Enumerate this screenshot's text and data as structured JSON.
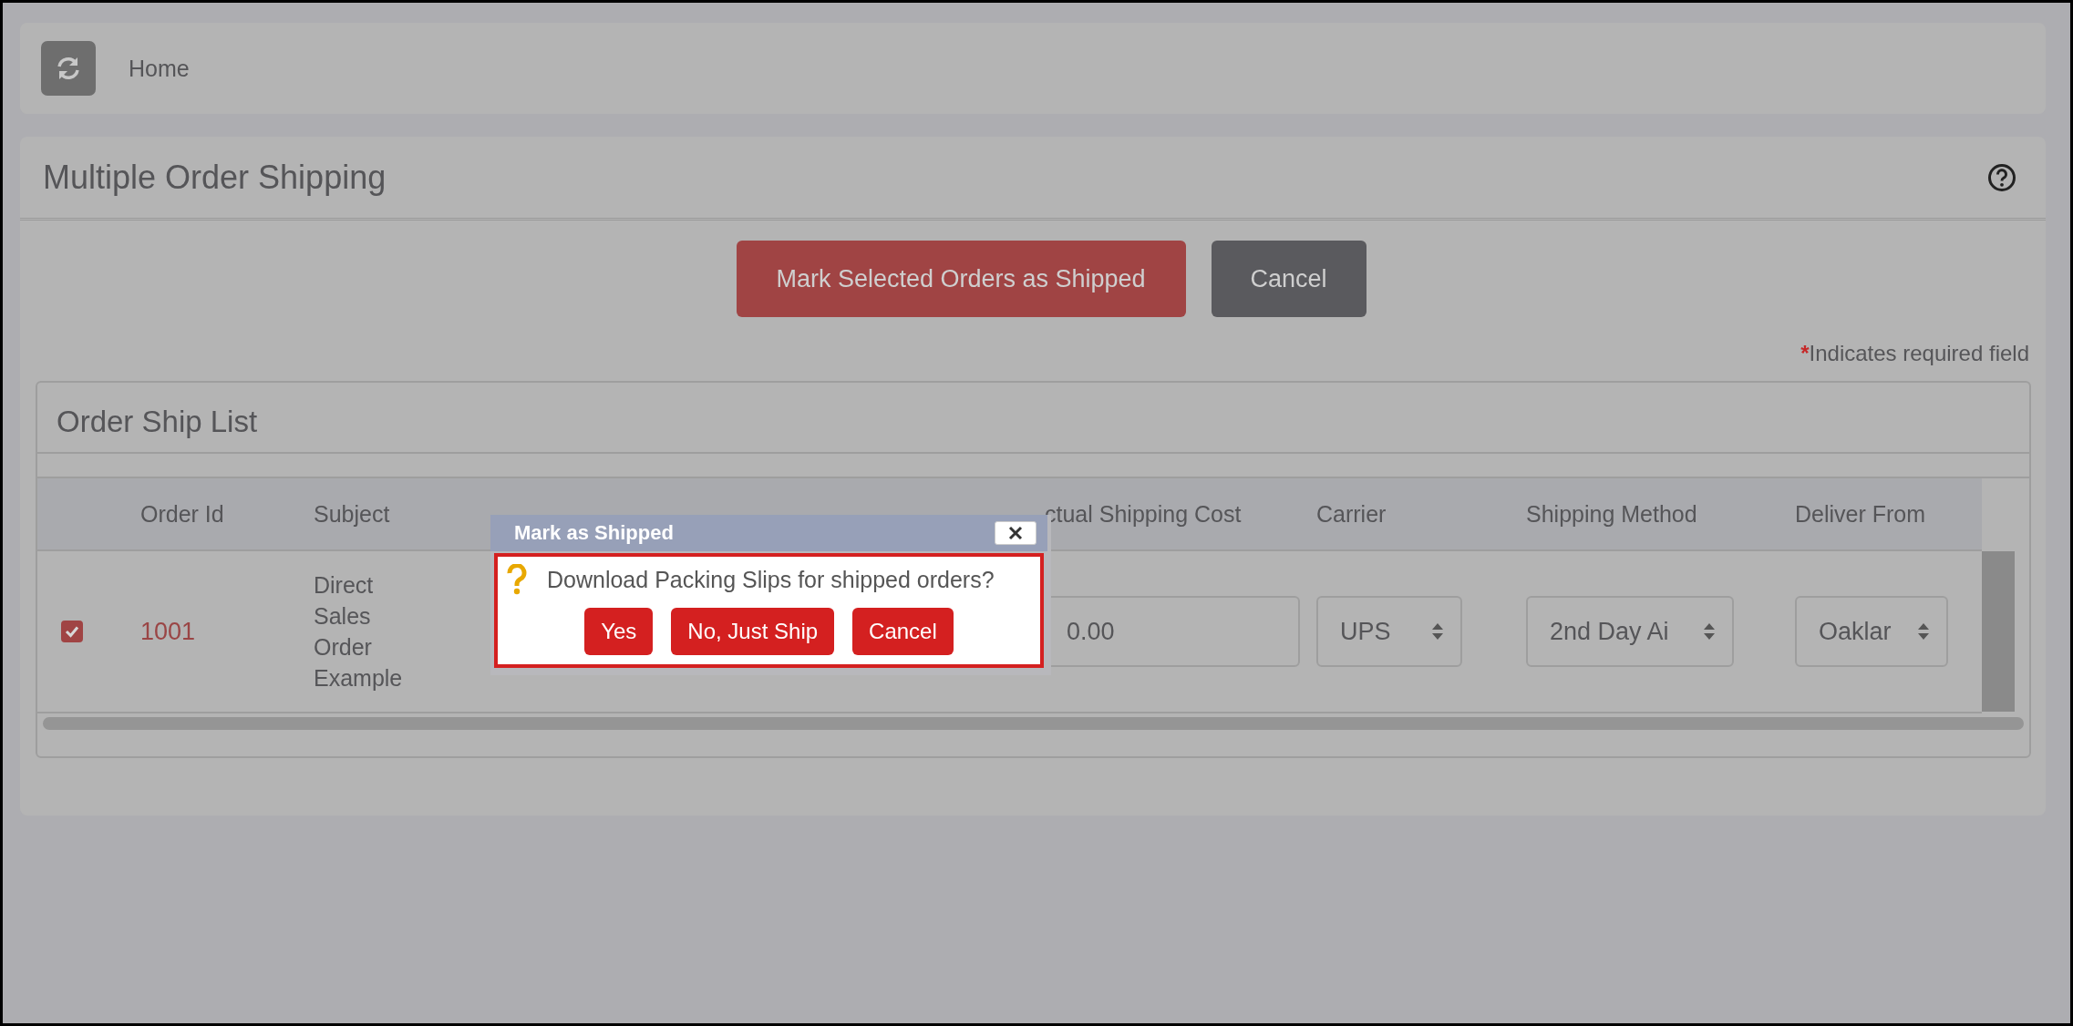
{
  "breadcrumb": {
    "items": [
      "Home"
    ]
  },
  "page": {
    "title": "Multiple Order Shipping"
  },
  "actions": [
    {
      "label": "Mark Selected Orders as Shipped",
      "kind": "primary"
    },
    {
      "label": "Cancel",
      "kind": "secondary"
    }
  ],
  "required_note": {
    "mark": "*",
    "text": "Indicates required field"
  },
  "order_list": {
    "title": "Order Ship List",
    "columns": [
      {
        "label": "Order Id"
      },
      {
        "label": "Subject"
      },
      {},
      {},
      {
        "label": "ctual Shipping Cost"
      },
      {
        "label": "Carrier"
      },
      {
        "label": "Shipping Method"
      },
      {
        "label": "Deliver From"
      }
    ],
    "rows": [
      {
        "checked": true,
        "order_id": "1001",
        "subject": "Direct Sales Order Example",
        "actual_shipping_cost": "0.00",
        "carrier": "UPS",
        "shipping_method": "2nd Day Ai",
        "deliver_from": "Oaklar"
      }
    ]
  },
  "dialog": {
    "title": "Mark as Shipped",
    "message": "Download Packing Slips for shipped orders?",
    "buttons": [
      "Yes",
      "No, Just Ship",
      "Cancel"
    ]
  }
}
